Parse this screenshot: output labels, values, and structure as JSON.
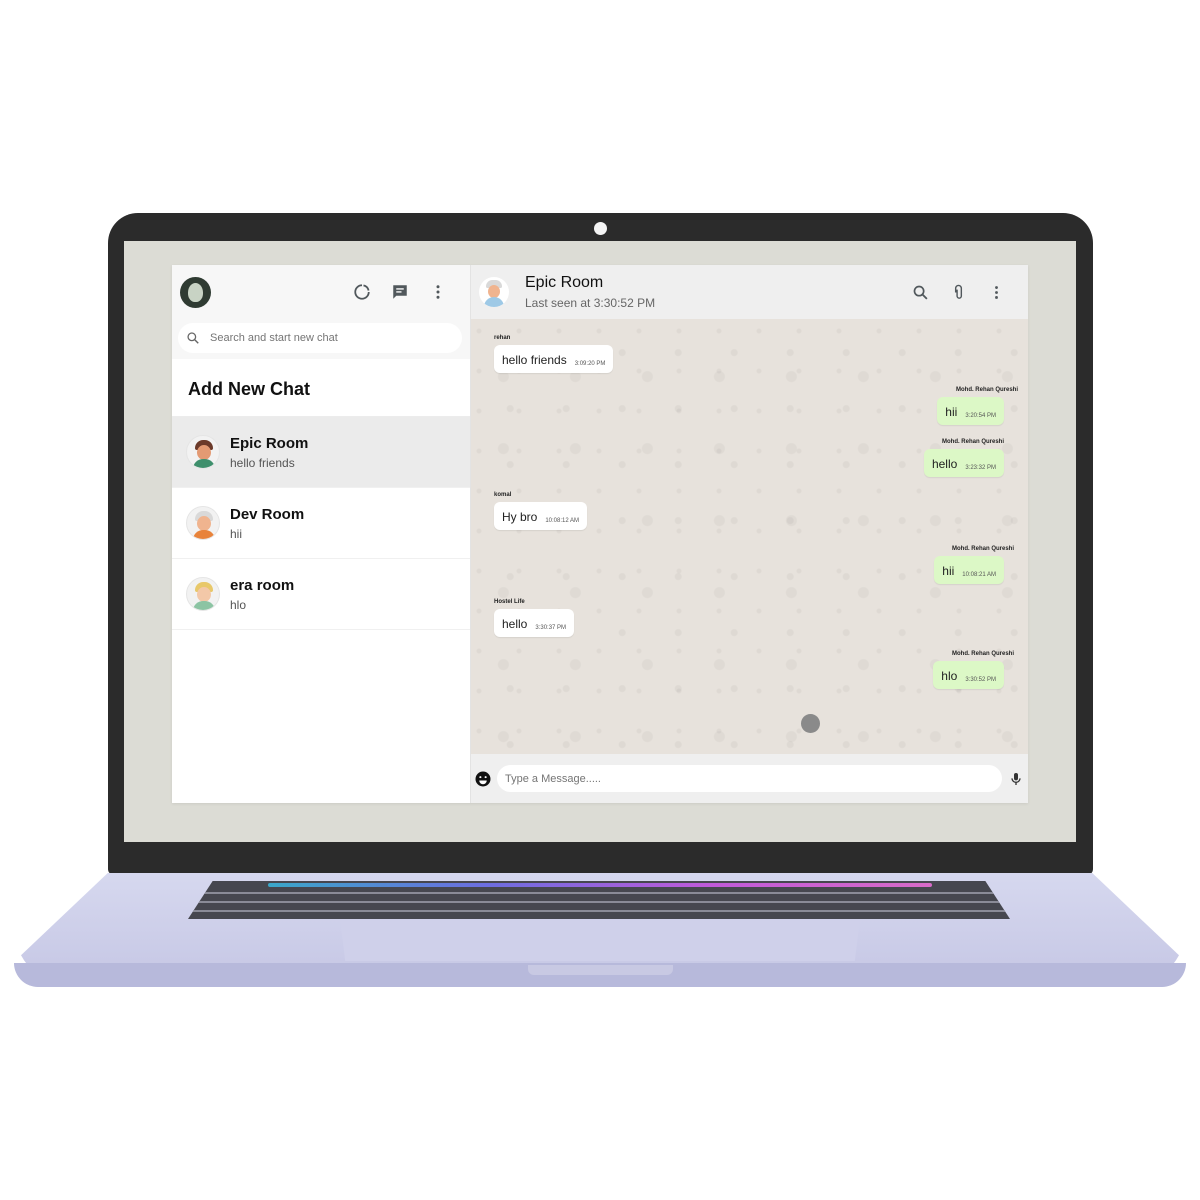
{
  "sidebar": {
    "search": {
      "placeholder": "Search and start new chat"
    },
    "add_new_chat": "Add New Chat",
    "chats": [
      {
        "name": "Epic Room",
        "last": "hello friends"
      },
      {
        "name": "Dev Room",
        "last": "hii"
      },
      {
        "name": "era room",
        "last": "hlo"
      }
    ]
  },
  "chat": {
    "room_name": "Epic Room",
    "last_seen": "Last seen at 3:30:52 PM",
    "messages": [
      {
        "sender": "rehan",
        "text": "hello friends",
        "time": "3:09:20 PM"
      },
      {
        "sender": "Mohd. Rehan Qureshi",
        "text": "hii",
        "time": "3:20:54 PM"
      },
      {
        "sender": "Mohd. Rehan Qureshi",
        "text": "hello",
        "time": "3:23:32 PM"
      },
      {
        "sender": "komal",
        "text": "Hy bro",
        "time": "10:08:12 AM"
      },
      {
        "sender": "Mohd. Rehan Qureshi",
        "text": "hii",
        "time": "10:08:21 AM"
      },
      {
        "sender": "Hostel Life",
        "text": "hello",
        "time": "3:30:37 PM"
      },
      {
        "sender": "Mohd. Rehan Qureshi",
        "text": "hlo",
        "time": "3:30:52 PM"
      }
    ],
    "composer": {
      "placeholder": "Type a Message....."
    }
  },
  "icons": {
    "status": "status-icon",
    "new_chat": "chat-icon",
    "menu": "more-vert-icon",
    "search": "search-icon",
    "attach": "attach-icon",
    "emoji": "emoji-icon",
    "mic": "mic-icon"
  },
  "colors": {
    "outgoing_bubble": "#dcf8c6",
    "incoming_bubble": "#ffffff",
    "chat_background": "#e7e2dc"
  }
}
